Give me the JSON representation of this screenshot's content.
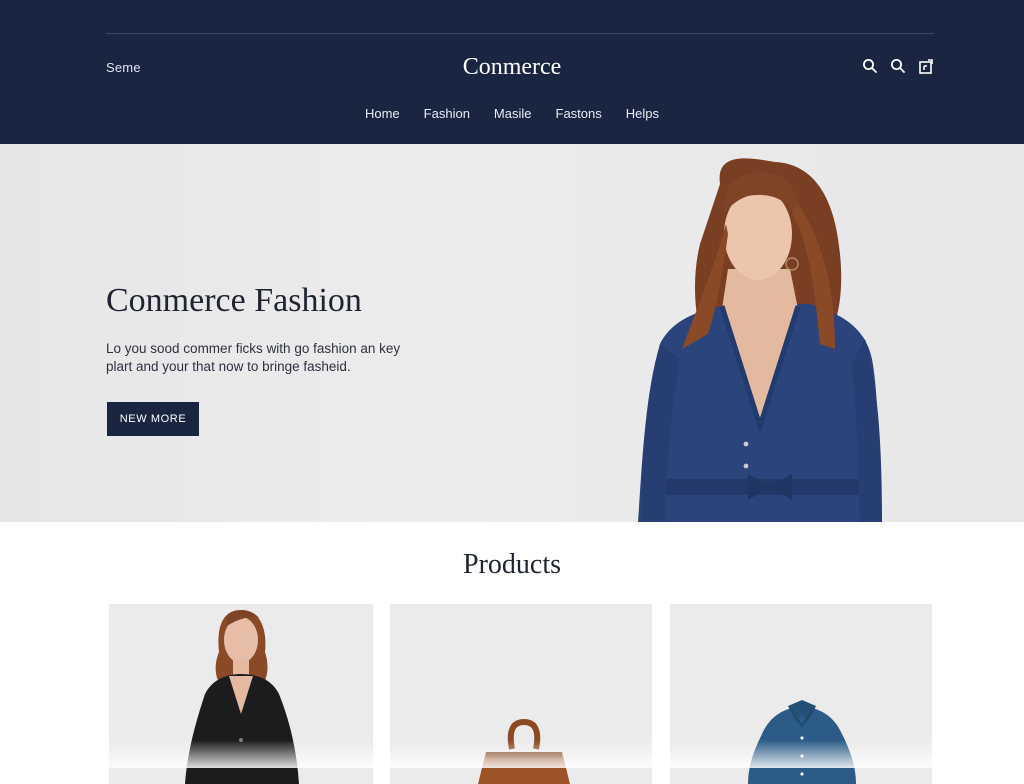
{
  "header": {
    "left_label": "Seme",
    "logo": "Conmerce",
    "icons": [
      "search-icon",
      "search-icon",
      "bag-icon"
    ]
  },
  "nav": {
    "items": [
      {
        "label": "Home"
      },
      {
        "label": "Fashion"
      },
      {
        "label": "Masile"
      },
      {
        "label": "Fastons"
      },
      {
        "label": "Helps"
      }
    ]
  },
  "hero": {
    "title": "Conmerce Fashion",
    "text_line1": "Lo you sood commer ficks with go fashion an key",
    "text_line2": "plart and your that now to bringe fasheid.",
    "button_label": "NEW MORE"
  },
  "products": {
    "title": "Products",
    "items": [
      {
        "image": "woman-black-blazer"
      },
      {
        "image": "brown-leather-bag"
      },
      {
        "image": "blue-denim-shirt"
      }
    ]
  },
  "colors": {
    "header_bg": "#1a2542",
    "accent": "#1a2542",
    "hero_bg": "#e8e8e9",
    "card_bg": "#ececec"
  }
}
